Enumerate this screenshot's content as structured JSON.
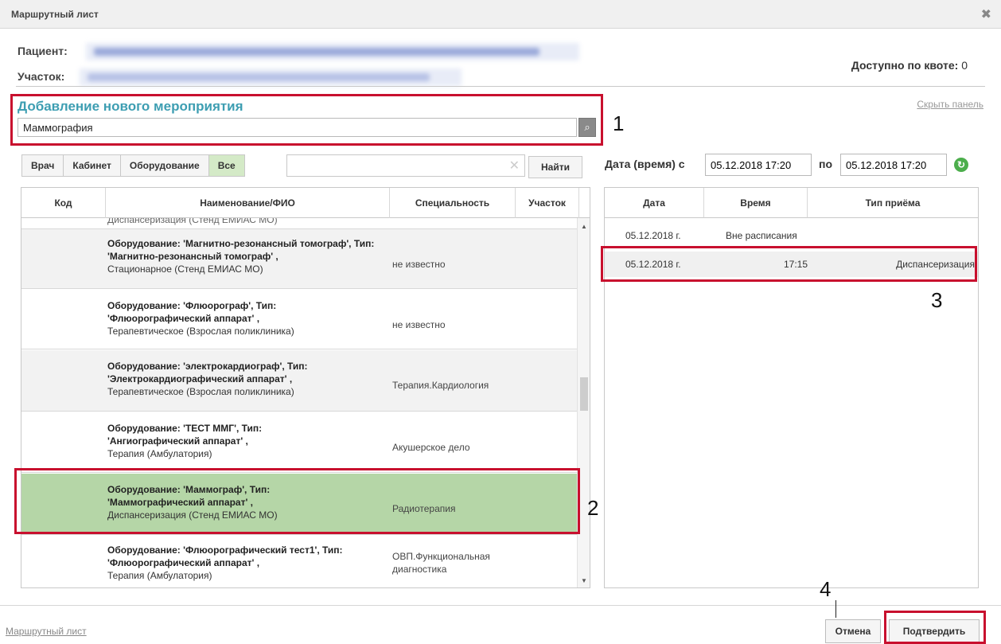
{
  "window": {
    "title": "Маршрутный лист"
  },
  "patient": {
    "label": "Пациент:",
    "district_label": "Участок:"
  },
  "quota": {
    "label": "Доступно по квоте:",
    "value": "0"
  },
  "hide_panel": "Скрыть панель",
  "add_event": {
    "title": "Добавление нового мероприятия",
    "value": "Маммография"
  },
  "filters": [
    {
      "label": "Врач"
    },
    {
      "label": "Кабинет"
    },
    {
      "label": "Оборудование"
    },
    {
      "label": "Все"
    }
  ],
  "find_button": "Найти",
  "date_range": {
    "label": "Дата (время) с",
    "from": "05.12.2018 17:20",
    "to_label": "по",
    "to": "05.12.2018 17:20"
  },
  "table": {
    "headers": [
      "Код",
      "Наименование/ФИО",
      "Специальность",
      "Участок"
    ],
    "partial_row": "Диспансеризация (Стенд ЕМИАС МО)",
    "rows": [
      {
        "name_bold": "Оборудование: 'Магнитно-резонансный томограф', Тип: 'Магнитно-резонансный томограф' ,",
        "name_sub": "Стационарное (Стенд ЕМИАС МО)",
        "spec": "не известно"
      },
      {
        "name_bold": "Оборудование: 'Флюорограф', Тип: 'Флюорографический аппарат' ,",
        "name_sub": "Терапевтическое (Взрослая поликлиника)",
        "spec": "не известно"
      },
      {
        "name_bold": "Оборудование: 'электрокардиограф', Тип: 'Электрокардиографический аппарат' ,",
        "name_sub": "Терапевтическое (Взрослая поликлиника)",
        "spec": "Терапия.Кардиология"
      },
      {
        "name_bold": "Оборудование: 'ТЕСТ ММГ', Тип: 'Ангиографический аппарат' ,",
        "name_sub": "Терапия (Амбулатория)",
        "spec": "Акушерское дело"
      },
      {
        "name_bold": "Оборудование: 'Маммограф', Тип: 'Маммографический аппарат' ,",
        "name_sub": "Диспансеризация (Стенд ЕМИАС МО)",
        "spec": "Радиотерапия"
      },
      {
        "name_bold": "Оборудование: 'Флюорографический тест1', Тип: 'Флюорографический аппарат' ,",
        "name_sub": "Терапия (Амбулатория)",
        "spec": "ОВП.Функциональная диагностика"
      }
    ]
  },
  "slots": {
    "headers": [
      "Дата",
      "Время",
      "Тип приёма"
    ],
    "rows": [
      {
        "date": "05.12.2018 г.",
        "time": "Вне расписания",
        "type": ""
      },
      {
        "date": "05.12.2018 г.",
        "time": "17:15",
        "type": "Диспансеризация"
      }
    ]
  },
  "annotations": [
    "1",
    "2",
    "3",
    "4"
  ],
  "footer": {
    "link": "Маршрутный лист",
    "cancel": "Отмена",
    "confirm": "Подтвердить"
  }
}
